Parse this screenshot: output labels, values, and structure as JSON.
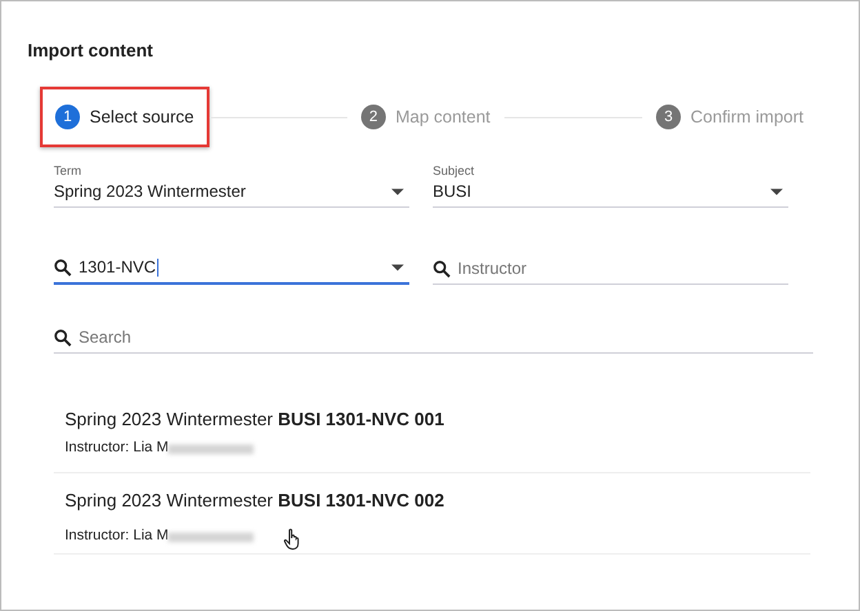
{
  "dialog": {
    "title": "Import content"
  },
  "steps": [
    {
      "number": "1",
      "label": "Select source",
      "selected": true
    },
    {
      "number": "2",
      "label": "Map content",
      "selected": false
    },
    {
      "number": "3",
      "label": "Confirm import",
      "selected": false
    }
  ],
  "filters": [
    {
      "kind": "select",
      "label": "Term",
      "value": "Spring 2023 Wintermester",
      "focused": false
    },
    {
      "kind": "select",
      "label": "Subject",
      "value": "BUSI",
      "focused": false
    },
    {
      "kind": "search-select",
      "value": "1301-NVC",
      "focused": true
    },
    {
      "kind": "search",
      "placeholder": "Instructor",
      "focused": false
    }
  ],
  "search": {
    "placeholder": "Search"
  },
  "results": [
    {
      "title": "Spring 2023 Wintermester **BUSI 1301-NVC 001**",
      "instructor": "Instructor: Lia M",
      "hovered": false
    },
    {
      "title": "Spring 2023 Wintermester **BUSI 1301-NVC 002**",
      "instructor": "Instructor: Lia M",
      "hovered": true
    }
  ]
}
